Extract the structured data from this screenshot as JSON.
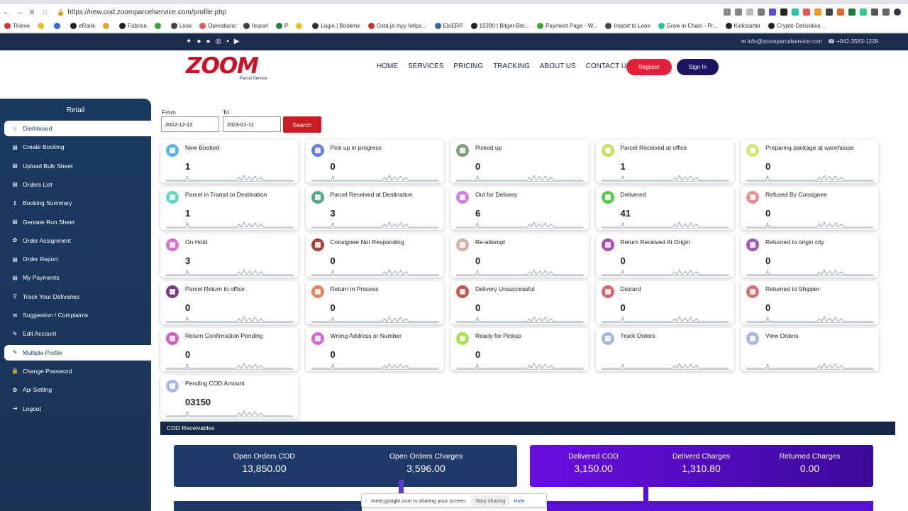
{
  "browser": {
    "url_host": "https://new.cod.zoomparcelservice.com",
    "url_path": "/profile.php",
    "bookmarks": [
      "Thieve",
      "",
      "",
      "eRank",
      "",
      "Fabrica",
      "",
      "Loox",
      "Operations",
      "Import",
      "P",
      "",
      "Login | Bookme",
      "Osta ja myy helpo...",
      "EloERP",
      "19390 | Bitget-Bet...",
      "Payment Page - W...",
      "Import to Loox",
      "Grow in Chain - Pr...",
      "Kickstarter",
      "Crypto Derivative..."
    ]
  },
  "topstrip": {
    "email": "info@zoomparcelservice.com",
    "phone": "+042-3583-1229"
  },
  "brand": {
    "name": "ZOOM",
    "tagline": "Parcel Service",
    "primary": "#1b2c4d",
    "accent": "#cc1027"
  },
  "nav": {
    "items": [
      "HOME",
      "SERVICES",
      "PRICING",
      "TRACKING",
      "ABOUT US",
      "CONTACT US"
    ],
    "register": "Register",
    "signin": "Sign In"
  },
  "sidebar": {
    "title": "Retail",
    "items": [
      {
        "label": "Dashboard",
        "icon": "home-icon",
        "active": true
      },
      {
        "label": "Create Booking",
        "icon": "document-icon"
      },
      {
        "label": "Upload Bulk Sheet",
        "icon": "document-icon"
      },
      {
        "label": "Orders List",
        "icon": "document-icon"
      },
      {
        "label": "Booking Summary",
        "icon": "sort-icon"
      },
      {
        "label": "Genrate Run Sheet",
        "icon": "document-icon"
      },
      {
        "label": "Order Assignment",
        "icon": "gear-icon"
      },
      {
        "label": "Order Report",
        "icon": "document-icon"
      },
      {
        "label": "My Payments",
        "icon": "document-icon"
      },
      {
        "label": "Track Your Deliveries",
        "icon": "location-icon"
      },
      {
        "label": "Suggestion / Complaints",
        "icon": "mail-icon"
      },
      {
        "label": "Edit Account",
        "icon": "pencil-icon"
      },
      {
        "label": "Multiple Profile",
        "icon": "pencil-icon",
        "active": true
      },
      {
        "label": "Change Password",
        "icon": "lock-icon"
      },
      {
        "label": "Api Setting",
        "icon": "gear-icon"
      },
      {
        "label": "Logout",
        "icon": "logout-icon"
      }
    ]
  },
  "filters": {
    "from_label": "From",
    "to_label": "To",
    "from_value": "2022-12-12",
    "to_value": "2023-01-11",
    "search_label": "Search"
  },
  "cards": [
    {
      "title": "New Booked",
      "value": "1",
      "color": "#5cb3e6"
    },
    {
      "title": "Pick up in progress",
      "value": "0",
      "color": "#6b7fe0"
    },
    {
      "title": "Picked up",
      "value": "0",
      "color": "#7fa07f"
    },
    {
      "title": "Parcel Received at office",
      "value": "1",
      "color": "#c8e060"
    },
    {
      "title": "Preparing package at warehouse",
      "value": "0",
      "color": "#cde86a"
    },
    {
      "title": "Parcel in Transit to Destination",
      "value": "1",
      "color": "#5fdcbd"
    },
    {
      "title": "Parcel Received at Destination",
      "value": "3",
      "color": "#55a58a"
    },
    {
      "title": "Out for Delivery",
      "value": "6",
      "color": "#d37ee6"
    },
    {
      "title": "Delivered",
      "value": "41",
      "color": "#5ac74f"
    },
    {
      "title": "Refused By Consignee",
      "value": "0",
      "color": "#e6928e"
    },
    {
      "title": "On Hold",
      "value": "3",
      "color": "#d970d3"
    },
    {
      "title": "Consignee Not Responding",
      "value": "0",
      "color": "#a8433a"
    },
    {
      "title": "Re-attempt",
      "value": "0",
      "color": "#d7aea0"
    },
    {
      "title": "Return Received At Origin",
      "value": "0",
      "color": "#a64cb5"
    },
    {
      "title": "Returned to origin city",
      "value": "0",
      "color": "#9d55c0"
    },
    {
      "title": "Parcel Return to office",
      "value": "0",
      "color": "#7a3c80"
    },
    {
      "title": "Return In Process",
      "value": "0",
      "color": "#e6855f"
    },
    {
      "title": "Delivery Unsuccessful",
      "value": "0",
      "color": "#c9564a"
    },
    {
      "title": "Discard",
      "value": "0",
      "color": "#d9666a"
    },
    {
      "title": "Returned to Shipper",
      "value": "0",
      "color": "#d96e78"
    },
    {
      "title": "Return Confirmation Pending",
      "value": "0",
      "color": "#cf5fbd"
    },
    {
      "title": "Wrong Address or Number",
      "value": "0",
      "color": "#d46ad6"
    },
    {
      "title": "Ready for Pickup",
      "value": "0",
      "color": "#a8e050"
    },
    {
      "title": "Track Orders",
      "value": "",
      "color": "#a7b8dd"
    },
    {
      "title": "View Orders",
      "value": "",
      "color": "#a7b8dd"
    },
    {
      "title": "Pending COD Amount",
      "value": "03150",
      "color": "#a7b8dd"
    }
  ],
  "cod": {
    "header": "COD Receivables",
    "left": [
      {
        "label": "Open Orders COD",
        "value": "13,850.00"
      },
      {
        "label": "Open Orders Charges",
        "value": "3,596.00"
      }
    ],
    "right": [
      {
        "label": "Delivered COD",
        "value": "3,150.00"
      },
      {
        "label": "Deliverd Charges",
        "value": "1,310.80"
      },
      {
        "label": "Returned Charges",
        "value": "0.00"
      }
    ]
  },
  "share": {
    "text": "meet.google.com is sharing your screen.",
    "stop": "Stop sharing",
    "hide": "Hide"
  }
}
